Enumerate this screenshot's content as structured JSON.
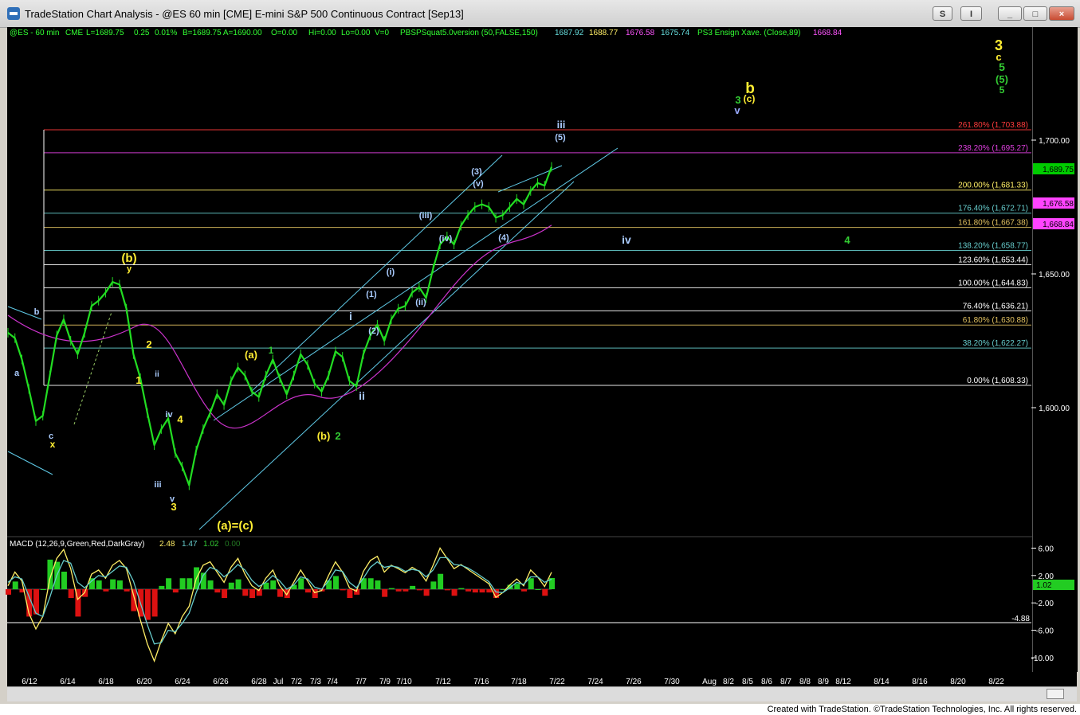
{
  "window": {
    "title": "TradeStation Chart Analysis - @ES 60 min [CME] E-mini S&P 500 Continuous Contract [Sep13]",
    "buttons": [
      "S",
      "I",
      "_",
      "□",
      "×"
    ]
  },
  "status_line": {
    "symbol": "@ES - 60 min",
    "exchange": "CME",
    "last": "L=1689.75",
    "change": "0.25",
    "change_pct": "0.01%",
    "bid_ask": "B=1689.75 A=1690.00",
    "open_change": "O=0.00",
    "high": "Hi=0.00",
    "low": "Lo=0.00",
    "volume": "V=0",
    "indicator1": "PBSPSquat5.0version (50,FALSE,150)",
    "ind_values": [
      "1687.92",
      "1688.77",
      "1676.58",
      "1675.74"
    ],
    "indicator2": "PS3 Ensign Xave. (Close,89)",
    "ind2_value": "1668.84"
  },
  "chart_data": [
    {
      "type": "line",
      "title": "",
      "series": [
        {
          "values": [
            1628,
            1626,
            1618,
            1607,
            1595,
            1597,
            1612,
            1627,
            1633,
            1625,
            1620,
            1628,
            1638,
            1640,
            1643,
            1647,
            1646,
            1637,
            1620,
            1611,
            1598,
            1586,
            1592,
            1596,
            1583,
            1578,
            1571,
            1584,
            1592,
            1598,
            1605,
            1601,
            1610,
            1615,
            1612,
            1606,
            1604,
            1612,
            1618,
            1611,
            1605,
            1612,
            1620,
            1616,
            1609,
            1606,
            1612,
            1621,
            1619,
            1610,
            1608,
            1620,
            1627,
            1631,
            1625,
            1633,
            1637,
            1638,
            1643,
            1645,
            1641,
            1652,
            1661,
            1664,
            1661,
            1668,
            1672,
            1675,
            1676,
            1675,
            1671,
            1672,
            1675,
            1678,
            1676,
            1681,
            1684,
            1683,
            1690
          ]
        }
      ],
      "ylim": [
        1571,
        1712
      ],
      "y_ticks": [
        "1,700.00",
        "1,650.00",
        "1,600.00"
      ],
      "x_ticks": [
        "6/12",
        "6/14",
        "6/18",
        "6/20",
        "6/24",
        "6/26",
        "6/28",
        "Jul",
        "7/2",
        "7/3",
        "7/4",
        "7/7",
        "7/9",
        "7/10",
        "7/12",
        "7/16",
        "7/18",
        "7/22",
        "7/24",
        "7/26",
        "7/30",
        "Aug",
        "8/2",
        "8/5",
        "8/6",
        "8/7",
        "8/8",
        "8/9",
        "8/12",
        "8/14",
        "8/16",
        "8/20",
        "8/22"
      ],
      "fib_levels": [
        {
          "label": "261.80% (1,703.88)",
          "value": 1703.88,
          "color": "#ff3b3b"
        },
        {
          "label": "238.20% (1,695.27)",
          "value": 1695.27,
          "color": "#e040e0"
        },
        {
          "label": "200.00% (1,681.33)",
          "value": 1681.33,
          "color": "#ffee66"
        },
        {
          "label": "176.40% (1,672.71)",
          "value": 1672.71,
          "color": "#66cccc"
        },
        {
          "label": "161.80% (1,667.38)",
          "value": 1667.38,
          "color": "#e0c060"
        },
        {
          "label": "138.20% (1,658.77)",
          "value": 1658.77,
          "color": "#66cccc"
        },
        {
          "label": "123.60% (1,653.44)",
          "value": 1653.44,
          "color": "#ffffff"
        },
        {
          "label": "100.00% (1,644.83)",
          "value": 1644.83,
          "color": "#ffffff"
        },
        {
          "label": "76.40% (1,636.21)",
          "value": 1636.21,
          "color": "#ffffff"
        },
        {
          "label": "61.80% (1,630.88)",
          "value": 1630.88,
          "color": "#e0c060"
        },
        {
          "label": "38.20% (1,622.27)",
          "value": 1622.27,
          "color": "#66cccc"
        },
        {
          "label": "0.00% (1,608.33)",
          "value": 1608.33,
          "color": "#ffffff"
        }
      ],
      "price_tags": [
        {
          "text": "1,689.75",
          "color": "#00cc00"
        },
        {
          "text": "1,676.58",
          "color": "#ff44ff"
        },
        {
          "text": "1,668.84",
          "color": "#ff44ff"
        }
      ],
      "wave_labels": [
        {
          "text": "3",
          "color": "#ffee33"
        },
        {
          "text": "c",
          "color": "#ffee33"
        },
        {
          "text": "5",
          "color": "#33cc33"
        },
        {
          "text": "(5)",
          "color": "#33cc33"
        },
        {
          "text": "5",
          "color": "#33cc33"
        },
        {
          "text": "b",
          "color": "#ffee33"
        },
        {
          "text": "3",
          "color": "#33cc33"
        },
        {
          "text": "(c)",
          "color": "#ffee33"
        },
        {
          "text": "v",
          "color": "#99aaff"
        },
        {
          "text": "iii",
          "color": "#aaccff"
        },
        {
          "text": "(5)",
          "color": "#aaccff"
        },
        {
          "text": "(3)",
          "color": "#aaccff"
        },
        {
          "text": "(v)",
          "color": "#aaccff"
        },
        {
          "text": "(iii)",
          "color": "#aaccff"
        },
        {
          "text": "(iv)",
          "color": "#aaccff"
        },
        {
          "text": "(4)",
          "color": "#aaccff"
        },
        {
          "text": "iv",
          "color": "#aaccff"
        },
        {
          "text": "4",
          "color": "#33cc33"
        },
        {
          "text": "(b)",
          "color": "#ffee33"
        },
        {
          "text": "y",
          "color": "#ffee33"
        },
        {
          "text": "(i)",
          "color": "#aaccff"
        },
        {
          "text": "(1)",
          "color": "#aaccff"
        },
        {
          "text": "(ii)",
          "color": "#aaccff"
        },
        {
          "text": "i",
          "color": "#aaccff"
        },
        {
          "text": "(2)",
          "color": "#aaccff"
        },
        {
          "text": "b",
          "color": "#aaccff"
        },
        {
          "text": "a",
          "color": "#aaccff"
        },
        {
          "text": "2",
          "color": "#ffee33"
        },
        {
          "text": "1",
          "color": "#ffee33"
        },
        {
          "text": "ii",
          "color": "#aaccff"
        },
        {
          "text": "(a)",
          "color": "#ffee33"
        },
        {
          "text": "1",
          "color": "#33cc33"
        },
        {
          "text": "ii",
          "color": "#aaccff"
        },
        {
          "text": "c",
          "color": "#aaccff"
        },
        {
          "text": "x",
          "color": "#ffee33"
        },
        {
          "text": "iv",
          "color": "#aaccff"
        },
        {
          "text": "4",
          "color": "#ffee33"
        },
        {
          "text": "(b)",
          "color": "#ffee33"
        },
        {
          "text": "2",
          "color": "#33cc33"
        },
        {
          "text": "iii",
          "color": "#aaccff"
        },
        {
          "text": "v",
          "color": "#aaccff"
        },
        {
          "text": "3",
          "color": "#ffee33"
        },
        {
          "text": "(a)=(c)",
          "color": "#ffee33"
        }
      ]
    },
    {
      "type": "bar",
      "title": "MACD (12,26,9,Green,Red,DarkGray)",
      "legend_values": [
        {
          "text": "2.48",
          "color": "#ffee66"
        },
        {
          "text": "1.47",
          "color": "#66cccc"
        },
        {
          "text": "1.02",
          "color": "#33cc33"
        },
        {
          "text": "0.00",
          "color": "#227722"
        }
      ],
      "y_ticks": [
        "6.00",
        "2.00",
        "-2.00",
        "-6.00",
        "-10.00"
      ],
      "ylim": [
        -11,
        7
      ],
      "markers": [
        {
          "text": "1.02",
          "color": "#33cc33"
        },
        {
          "text": "-4.88",
          "color": "#ffffff"
        }
      ],
      "series": [
        {
          "name": "MACD",
          "values": [
            0.5,
            2.5,
            1.2,
            -3.5,
            -5.8,
            -4.0,
            1.5,
            4.5,
            5.8,
            3.0,
            -1.5,
            -0.5,
            2.2,
            2.8,
            1.6,
            3.5,
            4.2,
            3.0,
            -0.8,
            -4.5,
            -8.0,
            -10.5,
            -7.5,
            -5.0,
            -6.5,
            -4.0,
            -2.5,
            1.5,
            3.5,
            4.0,
            2.5,
            1.0,
            3.2,
            4.5,
            2.2,
            0.5,
            -0.2,
            1.6,
            2.8,
            0.5,
            -0.8,
            1.0,
            2.8,
            1.2,
            -0.5,
            -0.2,
            2.0,
            4.0,
            2.5,
            0.2,
            -0.3,
            2.6,
            4.2,
            4.8,
            2.5,
            3.5,
            3.0,
            2.4,
            3.2,
            2.6,
            1.2,
            3.5,
            6.0,
            4.5,
            3.0,
            3.6,
            2.9,
            2.2,
            1.5,
            0.8,
            -1.2,
            -0.5,
            0.6,
            1.5,
            0.5,
            2.8,
            1.8,
            0.4,
            2.48
          ]
        },
        {
          "name": "Avg",
          "values": [
            1.0,
            1.8,
            1.5,
            -1.0,
            -3.5,
            -4.0,
            -1.2,
            2.0,
            4.2,
            3.8,
            1.0,
            0.2,
            1.2,
            2.0,
            1.8,
            2.6,
            3.4,
            3.2,
            1.2,
            -2.0,
            -5.2,
            -8.0,
            -7.8,
            -6.0,
            -6.2,
            -5.0,
            -3.5,
            -0.5,
            2.0,
            3.2,
            2.8,
            1.8,
            2.6,
            3.6,
            2.8,
            1.3,
            0.4,
            1.0,
            2.0,
            1.2,
            0.0,
            0.6,
            1.8,
            1.5,
            0.3,
            0.0,
            1.2,
            2.8,
            2.6,
            1.0,
            0.2,
            1.6,
            3.2,
            4.0,
            3.2,
            3.4,
            3.2,
            2.6,
            2.9,
            2.7,
            1.8,
            2.8,
            4.6,
            4.6,
            3.6,
            3.5,
            3.1,
            2.5,
            1.8,
            1.1,
            -0.4,
            -0.5,
            0.2,
            1.0,
            0.7,
            1.8,
            1.8,
            1.0,
            1.47
          ]
        },
        {
          "name": "Diff",
          "values": [
            -0.5,
            0.7,
            -0.3,
            -2.5,
            -2.3,
            0.0,
            2.7,
            2.5,
            1.6,
            -0.8,
            -2.5,
            -0.7,
            1.0,
            0.8,
            -0.2,
            0.9,
            0.8,
            -0.2,
            -2.0,
            -2.5,
            -2.8,
            -2.5,
            0.3,
            1.0,
            -0.3,
            1.0,
            1.0,
            2.0,
            1.5,
            0.8,
            -0.3,
            -0.8,
            0.6,
            0.9,
            -0.6,
            -0.8,
            -0.6,
            0.6,
            0.8,
            -0.7,
            -0.8,
            0.4,
            1.0,
            -0.3,
            -0.8,
            -0.2,
            0.8,
            1.2,
            -0.1,
            -0.8,
            -0.5,
            1.0,
            1.0,
            0.8,
            -0.7,
            0.1,
            -0.2,
            -0.2,
            0.3,
            -0.1,
            -0.6,
            0.7,
            1.4,
            -0.1,
            -0.6,
            0.1,
            -0.2,
            -0.3,
            -0.3,
            -0.3,
            -0.8,
            0.0,
            0.4,
            0.5,
            -0.2,
            1.0,
            0.0,
            -0.6,
            1.02
          ]
        }
      ]
    }
  ],
  "footer": {
    "text": "Created with TradeStation. ©TradeStation Technologies, Inc. All rights reserved."
  }
}
